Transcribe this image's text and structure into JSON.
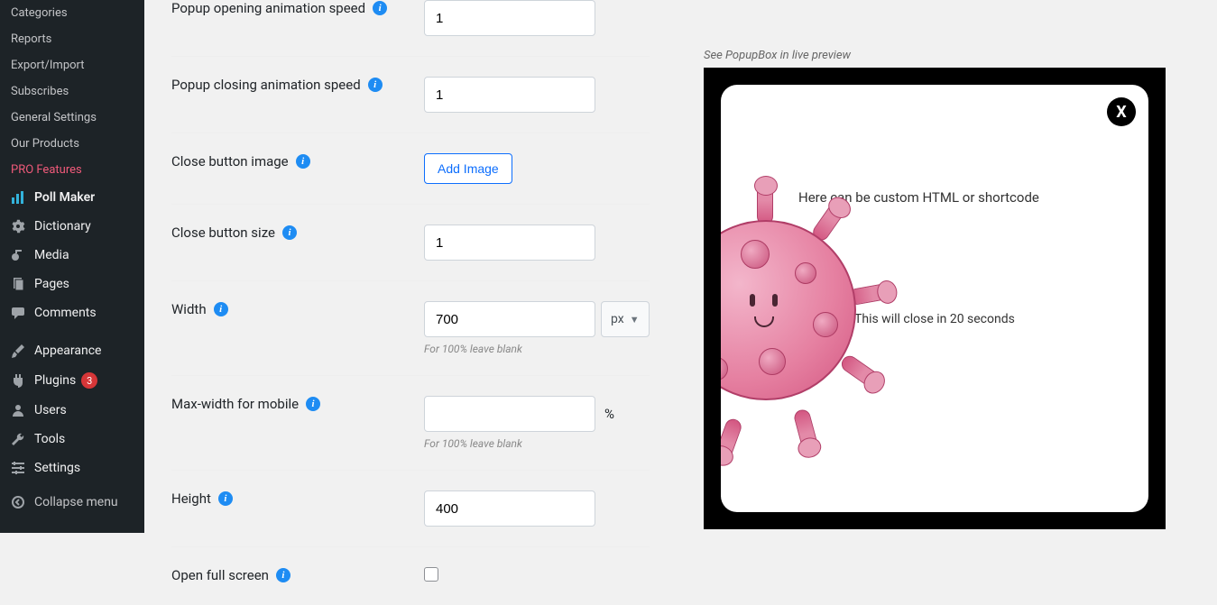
{
  "sidebar": {
    "submenu": [
      {
        "label": "Categories"
      },
      {
        "label": "Reports"
      },
      {
        "label": "Export/Import"
      },
      {
        "label": "Subscribes"
      },
      {
        "label": "General Settings"
      },
      {
        "label": "Our Products"
      },
      {
        "label": "PRO Features",
        "highlight": true
      }
    ],
    "menu": [
      {
        "label": "Poll Maker",
        "icon": "chart-bar"
      },
      {
        "label": "Dictionary",
        "icon": "gear"
      },
      {
        "label": "Media",
        "icon": "media"
      },
      {
        "label": "Pages",
        "icon": "page"
      },
      {
        "label": "Comments",
        "icon": "comment"
      }
    ],
    "menu2": [
      {
        "label": "Appearance",
        "icon": "brush"
      },
      {
        "label": "Plugins",
        "icon": "plug",
        "badge": "3"
      },
      {
        "label": "Users",
        "icon": "user"
      },
      {
        "label": "Tools",
        "icon": "wrench"
      },
      {
        "label": "Settings",
        "icon": "sliders"
      }
    ],
    "collapse_label": "Collapse menu"
  },
  "form": {
    "open_speed_label": "Popup opening animation speed",
    "open_speed_value": "1",
    "close_speed_label": "Popup closing animation speed",
    "close_speed_value": "1",
    "close_image_label": "Close button image",
    "add_image_button": "Add Image",
    "close_size_label": "Close button size",
    "close_size_value": "1",
    "width_label": "Width",
    "width_value": "700",
    "width_unit": "px",
    "width_help": "For 100% leave blank",
    "maxwidth_label": "Max-width for mobile",
    "maxwidth_value": "",
    "maxwidth_suffix": "%",
    "maxwidth_help": "For 100% leave blank",
    "height_label": "Height",
    "height_value": "400",
    "fullscreen_label": "Open full screen"
  },
  "preview": {
    "caption": "See PopupBox in live preview",
    "close_symbol": "X",
    "custom_html_text": "Here can be custom HTML or shortcode",
    "countdown_text": "This will close in 20 seconds"
  }
}
